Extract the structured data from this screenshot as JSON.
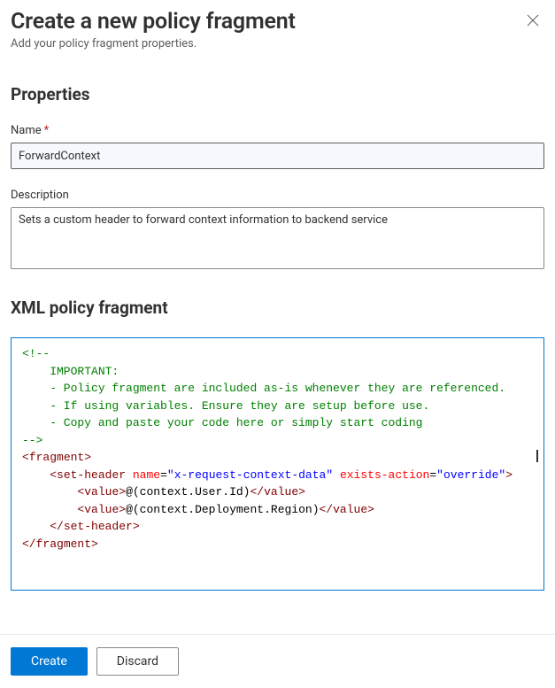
{
  "header": {
    "title": "Create a new policy fragment",
    "subtitle": "Add your policy fragment properties."
  },
  "properties": {
    "heading": "Properties",
    "name_label": "Name",
    "name_value": "ForwardContext",
    "description_label": "Description",
    "description_value": "Sets a custom header to forward context information to backend service"
  },
  "xml": {
    "heading": "XML policy fragment",
    "code": {
      "comment_start": "<!--",
      "comment_l1": "    IMPORTANT:",
      "comment_l2": "    - Policy fragment are included as-is whenever they are referenced.",
      "comment_l3": "    - If using variables. Ensure they are setup before use.",
      "comment_l4": "    - Copy and paste your code here or simply start coding",
      "comment_end": "-->",
      "frag_open_lt": "<",
      "frag_open_name": "fragment",
      "frag_open_gt": ">",
      "sh_open_lt": "<",
      "sh_open_name": "set-header",
      "sh_attr1_name": "name",
      "sh_attr1_eq": "=",
      "sh_attr1_val": "\"x-request-context-data\"",
      "sh_attr2_name": "exists-action",
      "sh_attr2_eq": "=",
      "sh_attr2_val": "\"override\"",
      "sh_open_gt": ">",
      "val1_open_lt": "<",
      "val1_open_name": "value",
      "val1_open_gt": ">",
      "val1_text": "@(context.User.Id)",
      "val1_close": "</",
      "val1_close_name": "value",
      "val1_close_gt": ">",
      "val2_open_lt": "<",
      "val2_open_name": "value",
      "val2_open_gt": ">",
      "val2_text": "@(context.Deployment.Region)",
      "val2_close": "</",
      "val2_close_name": "value",
      "val2_close_gt": ">",
      "sh_close": "</",
      "sh_close_name": "set-header",
      "sh_close_gt": ">",
      "frag_close": "</",
      "frag_close_name": "fragment",
      "frag_close_gt": ">"
    }
  },
  "footer": {
    "create_label": "Create",
    "discard_label": "Discard"
  }
}
